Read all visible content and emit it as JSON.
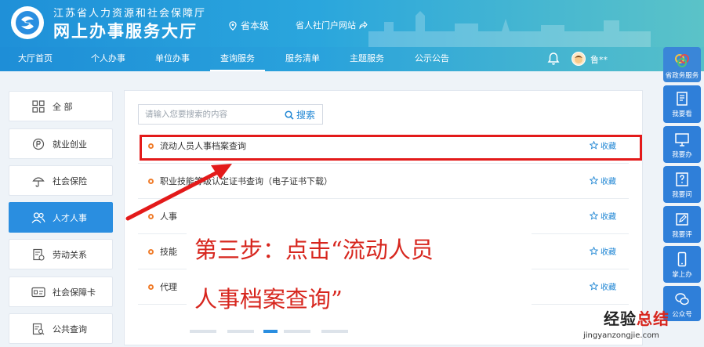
{
  "header": {
    "org_name": "江苏省人力资源和社会保障厅",
    "site_name": "网上办事服务大厅",
    "location": "省本级",
    "portal_link": "省人社门户网站"
  },
  "nav": {
    "items": [
      {
        "label": "大厅首页"
      },
      {
        "label": "个人办事"
      },
      {
        "label": "单位办事"
      },
      {
        "label": "查询服务",
        "active": true
      },
      {
        "label": "服务清单"
      },
      {
        "label": "主题服务"
      },
      {
        "label": "公示公告"
      }
    ],
    "user_name": "鲁**"
  },
  "sidebar": {
    "items": [
      {
        "label": "全 部",
        "icon": "grid-icon"
      },
      {
        "label": "就业创业",
        "icon": "employment-icon"
      },
      {
        "label": "社会保险",
        "icon": "umbrella-icon"
      },
      {
        "label": "人才人事",
        "icon": "people-icon",
        "active": true
      },
      {
        "label": "劳动关系",
        "icon": "document-icon"
      },
      {
        "label": "社会保障卡",
        "icon": "card-icon"
      },
      {
        "label": "公共查询",
        "icon": "search-list-icon"
      }
    ]
  },
  "search": {
    "placeholder": "请输入您要搜索的内容",
    "button_label": "搜索"
  },
  "services": [
    {
      "title": "流动人员人事档案查询",
      "fav": "收藏"
    },
    {
      "title": "职业技能等级认定证书查询（电子证书下载）",
      "fav": "收藏"
    },
    {
      "title": "人事",
      "fav": "收藏"
    },
    {
      "title": "技能",
      "fav": "收藏"
    },
    {
      "title": "代理",
      "fav": "收藏"
    }
  ],
  "callout": {
    "line1": "第三步：点击“流动人员",
    "line2": "人事档案查询”"
  },
  "right_toolbar": [
    {
      "label": "省政务服务",
      "icon": "gov-logo-icon"
    },
    {
      "label": "我要看",
      "icon": "book-icon"
    },
    {
      "label": "我要办",
      "icon": "monitor-icon"
    },
    {
      "label": "我要问",
      "icon": "question-icon"
    },
    {
      "label": "我要评",
      "icon": "edit-icon"
    },
    {
      "label": "掌上办",
      "icon": "phone-icon"
    },
    {
      "label": "公众号",
      "icon": "wechat-icon"
    }
  ],
  "watermark": {
    "main_black": "经验",
    "main_red": "总结",
    "url": "jingyanzongjie.com"
  },
  "colors": {
    "header_start": "#1f90d8",
    "header_end": "#5bc3c8",
    "accent_blue": "#2a8ee0",
    "highlight_red": "#e31a1a",
    "bullet_orange": "#f07d2c"
  }
}
